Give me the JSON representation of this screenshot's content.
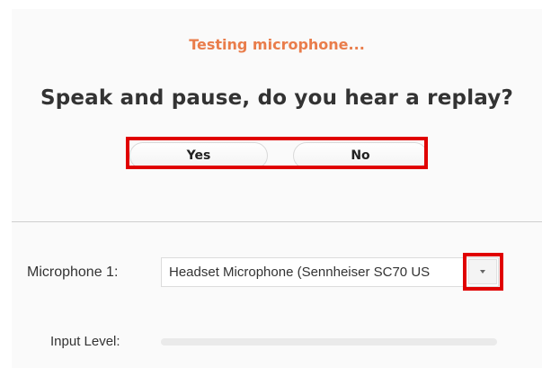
{
  "status_text": "Testing microphone...",
  "question": "Speak and pause, do you hear a replay?",
  "buttons": {
    "yes": "Yes",
    "no": "No"
  },
  "microphone": {
    "label": "Microphone 1:",
    "selected_device": "Headset Microphone (Sennheiser SC70 US"
  },
  "input_level": {
    "label": "Input Level:",
    "level_percent": 0
  },
  "colors": {
    "status": "#e97d4b",
    "highlight": "#e00000"
  }
}
